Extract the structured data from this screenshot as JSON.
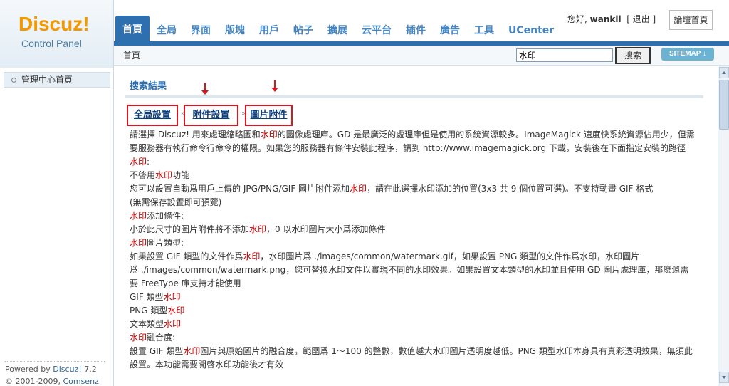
{
  "logo": {
    "brand": "Discuz!",
    "subtitle": "Control Panel"
  },
  "nav": {
    "tabs": [
      {
        "label": "首頁",
        "active": true
      },
      {
        "label": "全局",
        "active": false
      },
      {
        "label": "界面",
        "active": false
      },
      {
        "label": "版塊",
        "active": false
      },
      {
        "label": "用戶",
        "active": false
      },
      {
        "label": "帖子",
        "active": false
      },
      {
        "label": "擴展",
        "active": false
      },
      {
        "label": "云平台",
        "active": false
      },
      {
        "label": "插件",
        "active": false
      },
      {
        "label": "廣告",
        "active": false
      },
      {
        "label": "工具",
        "active": false
      },
      {
        "label": "UCenter",
        "active": false
      }
    ],
    "greeting": "您好,",
    "username": "wankll",
    "logout_label": "[ 退出 ]",
    "forum_home_label": "論壇首頁"
  },
  "subbar": {
    "breadcrumb": "首頁",
    "search_value": "水印",
    "search_button": "搜索",
    "sitemap_label": "SITEMAP ↓"
  },
  "sidebar": {
    "items": [
      {
        "label": "管理中心首頁"
      }
    ],
    "powered_prefix": "Powered by ",
    "powered_link": "Discuz!",
    "version": " 7.2",
    "copyright_prefix": "© 2001-2009, ",
    "copyright_link": "Comsenz Inc."
  },
  "main": {
    "section_title": "搜索結果",
    "crumbs": [
      "全局設置",
      "附件設置",
      "圖片附件"
    ],
    "separator": "»",
    "lines": [
      [
        {
          "t": "請選擇 Discuz! 用來處理縮略圖和"
        },
        {
          "t": "水印",
          "hl": true
        },
        {
          "t": "的圖像處理庫。GD 是最廣泛的處理庫但是使用的系統資源較多。ImageMagick 速度快系統資源佔用少，但需"
        }
      ],
      [
        {
          "t": "要服務器有執行命令行命令的權限。如果您的服務器有條件安裝此程序，請到 http://www.imagemagick.org 下載，安裝後在下面指定安裝的路徑"
        }
      ],
      [
        {
          "t": "水印",
          "hl": true
        },
        {
          "t": ":"
        }
      ],
      [
        {
          "t": "不啓用"
        },
        {
          "t": "水印",
          "hl": true
        },
        {
          "t": "功能"
        }
      ],
      [
        {
          "t": "您可以設置自動爲用戶上傳的 JPG/PNG/GIF 圖片附件添加"
        },
        {
          "t": "水印",
          "hl": true
        },
        {
          "t": "，請在此選擇水印添加的位置(3x3 共 9 個位置可選)。不支持動畫 GIF 格式"
        }
      ],
      [
        {
          "t": "(無需保存設置即可預覽)"
        }
      ],
      [
        {
          "t": "水印",
          "hl": true
        },
        {
          "t": "添加條件:"
        }
      ],
      [
        {
          "t": "小於此尺寸的圖片附件將不添加"
        },
        {
          "t": "水印",
          "hl": true
        },
        {
          "t": "，0 以水印圖片大小爲添加條件"
        }
      ],
      [
        {
          "t": "水印",
          "hl": true
        },
        {
          "t": "圖片類型:"
        }
      ],
      [
        {
          "t": "如果設置 GIF 類型的文件作爲"
        },
        {
          "t": "水印",
          "hl": true
        },
        {
          "t": "，水印圖片爲 ./images/common/watermark.gif，如果設置 PNG 類型的文件作爲水印，水印圖片"
        }
      ],
      [
        {
          "t": "爲 ./images/common/watermark.png，您可替換水印文件以實現不同的水印效果。如果設置文本類型的水印並且使用 GD 圖片處理庫，那麽還需"
        }
      ],
      [
        {
          "t": "要 FreeType 庫支持才能使用"
        }
      ],
      [
        {
          "t": "GIF 類型"
        },
        {
          "t": "水印",
          "hl": true
        }
      ],
      [
        {
          "t": "PNG 類型"
        },
        {
          "t": "水印",
          "hl": true
        }
      ],
      [
        {
          "t": "文本類型"
        },
        {
          "t": "水印",
          "hl": true
        }
      ],
      [
        {
          "t": "水印",
          "hl": true
        },
        {
          "t": "融合度:"
        }
      ],
      [
        {
          "t": "設置 GIF 類型"
        },
        {
          "t": "水印",
          "hl": true
        },
        {
          "t": "圖片與原始圖片的融合度，範圍爲 1～100 的整數，數值越大水印圖片透明度越低。PNG 類型水印本身具有真彩透明效果，無須此"
        }
      ],
      [
        {
          "t": "設置。本功能需要開啓水印功能後才有效"
        }
      ]
    ]
  },
  "colors": {
    "accent": "#2e6fb0",
    "highlight": "#cc0000",
    "annotation": "#d8171f",
    "logo": "#f39800"
  }
}
